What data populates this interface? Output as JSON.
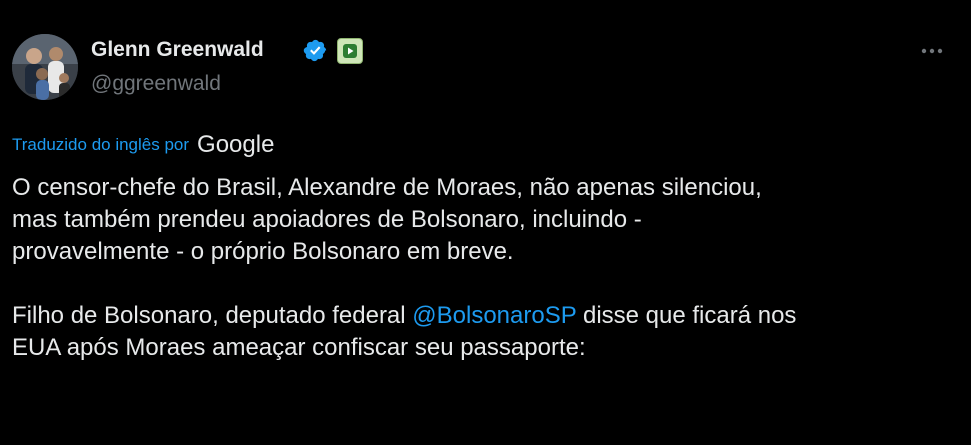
{
  "author": {
    "display_name": "Glenn Greenwald",
    "handle": "@ggreenwald",
    "verified_icon": "verified-badge-icon",
    "affiliate_icon": "play-badge-icon"
  },
  "menu": {
    "more_icon": "more-horizontal-icon"
  },
  "translation": {
    "label": "Traduzido do inglês por",
    "provider": "Google"
  },
  "body": {
    "para1": [
      "O censor-chefe do Brasil, Alexandre de Moraes, não apenas silenciou,",
      "mas também prendeu apoiadores de Bolsonaro, incluindo -",
      "provavelmente - o próprio Bolsonaro em breve."
    ],
    "para2_line1_before": "Filho de Bolsonaro, deputado federal ",
    "mention": "@BolsonaroSP",
    "para2_line1_after": " disse que ficará nos",
    "para2_line2": "EUA após Moraes ameaçar confiscar seu passaporte:"
  },
  "colors": {
    "background": "#000000",
    "text": "#e7e9ea",
    "muted": "#71767b",
    "link": "#1d9bf0",
    "verified": "#1d9bf0"
  }
}
